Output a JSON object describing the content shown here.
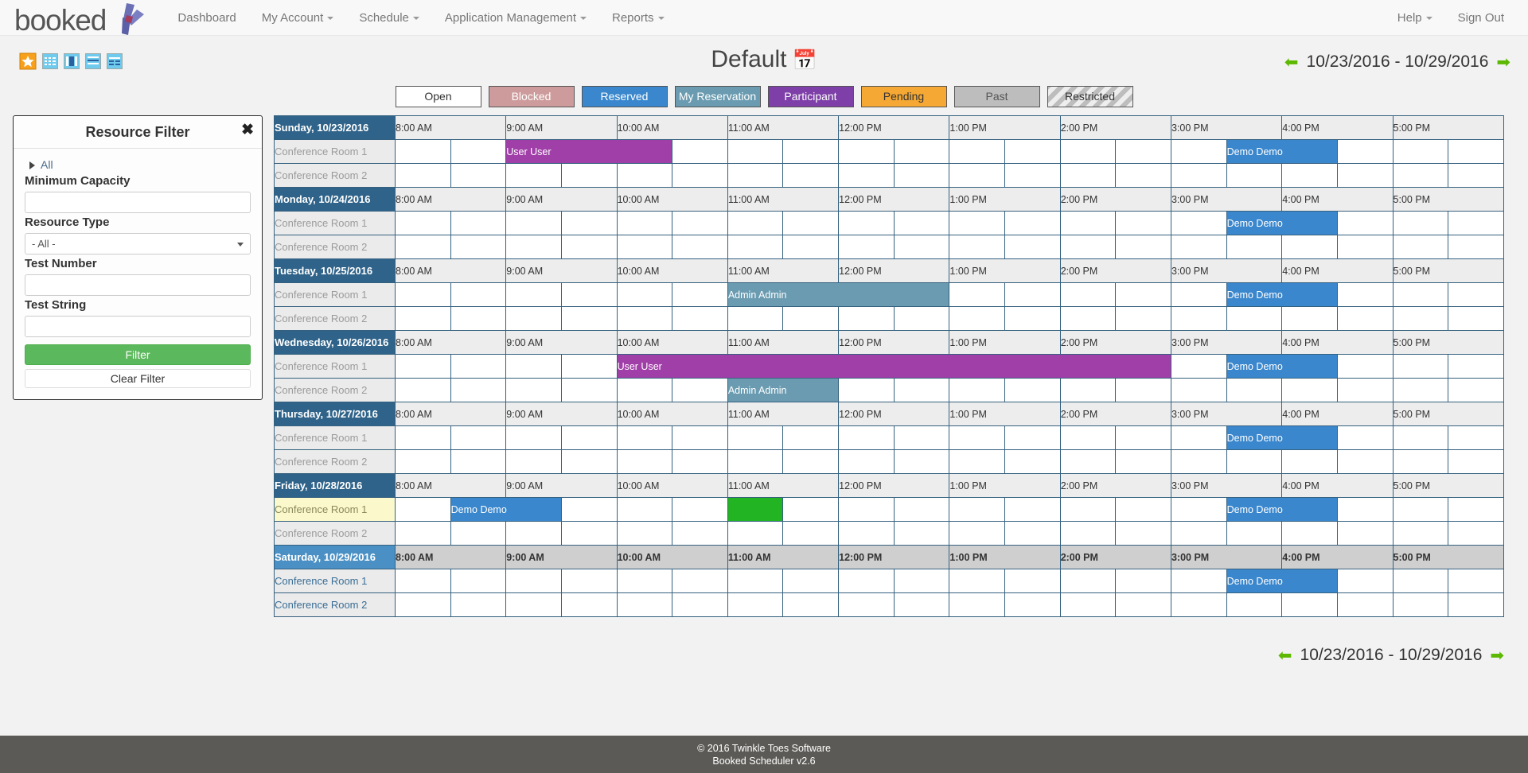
{
  "navbar": {
    "brand": "booked",
    "links": [
      {
        "label": "Dashboard",
        "caret": false
      },
      {
        "label": "My Account",
        "caret": true
      },
      {
        "label": "Schedule",
        "caret": true
      },
      {
        "label": "Application Management",
        "caret": true
      },
      {
        "label": "Reports",
        "caret": true
      }
    ],
    "right_links": [
      {
        "label": "Help",
        "caret": true
      },
      {
        "label": "Sign Out",
        "caret": false
      }
    ]
  },
  "toolbar": {
    "icons": [
      "star-icon",
      "calendar-month-view-icon",
      "calendar-day-view-icon",
      "calendar-week-view-icon",
      "calendar-list-view-icon"
    ]
  },
  "header": {
    "title": "Default",
    "calendar_icon": "📅",
    "date_range": "10/23/2016 - 10/29/2016",
    "prev_arrow": "⬅",
    "next_arrow": "➡"
  },
  "legend": [
    {
      "label": "Open",
      "bg": "#ffffff",
      "fg": "#333333",
      "striped": false
    },
    {
      "label": "Blocked",
      "bg": "#cd9b9b",
      "fg": "#ffffff",
      "striped": false
    },
    {
      "label": "Reserved",
      "bg": "#3a87cd",
      "fg": "#ffffff",
      "striped": false
    },
    {
      "label": "My Reservation",
      "bg": "#6a9bb0",
      "fg": "#ffffff",
      "striped": false
    },
    {
      "label": "Participant",
      "bg": "#7e3fa8",
      "fg": "#ffffff",
      "striped": false
    },
    {
      "label": "Pending",
      "bg": "#f5a833",
      "fg": "#333333",
      "striped": false
    },
    {
      "label": "Past",
      "bg": "#bdbdbd",
      "fg": "#555555",
      "striped": false
    },
    {
      "label": "Restricted",
      "bg": "#bdbdbd",
      "fg": "#333333",
      "striped": true
    }
  ],
  "filter": {
    "title": "Resource Filter",
    "close_label": "✖",
    "tree_all": "All",
    "min_capacity_label": "Minimum Capacity",
    "min_capacity_value": "",
    "resource_type_label": "Resource Type",
    "resource_type_value": "- All -",
    "test_number_label": "Test Number",
    "test_number_value": "",
    "test_string_label": "Test String",
    "test_string_value": "",
    "filter_button": "Filter",
    "clear_button": "Clear Filter"
  },
  "schedule": {
    "times": [
      "8:00 AM",
      "9:00 AM",
      "10:00 AM",
      "11:00 AM",
      "12:00 PM",
      "1:00 PM",
      "2:00 PM",
      "3:00 PM",
      "4:00 PM",
      "5:00 PM"
    ],
    "rooms": [
      "Conference Room 1",
      "Conference Room 2"
    ],
    "days": [
      {
        "date": "Sunday, 10/23/2016",
        "today": false,
        "rows": [
          {
            "room": "Conference Room 1",
            "highlight": false,
            "reservations": [
              {
                "label": "User User",
                "start": 2,
                "span": 3,
                "color": "#a13fa8"
              },
              {
                "label": "Demo Demo",
                "start": 15,
                "span": 2,
                "color": "#3a87cd"
              }
            ]
          },
          {
            "room": "Conference Room 2",
            "highlight": false,
            "reservations": []
          }
        ]
      },
      {
        "date": "Monday, 10/24/2016",
        "today": false,
        "rows": [
          {
            "room": "Conference Room 1",
            "highlight": false,
            "reservations": [
              {
                "label": "Demo Demo",
                "start": 15,
                "span": 2,
                "color": "#3a87cd"
              }
            ]
          },
          {
            "room": "Conference Room 2",
            "highlight": false,
            "reservations": []
          }
        ]
      },
      {
        "date": "Tuesday, 10/25/2016",
        "today": false,
        "rows": [
          {
            "room": "Conference Room 1",
            "highlight": false,
            "reservations": [
              {
                "label": "Admin Admin",
                "start": 6,
                "span": 4,
                "color": "#6a9bb0"
              },
              {
                "label": "Demo Demo",
                "start": 15,
                "span": 2,
                "color": "#3a87cd"
              }
            ]
          },
          {
            "room": "Conference Room 2",
            "highlight": false,
            "reservations": []
          }
        ]
      },
      {
        "date": "Wednesday, 10/26/2016",
        "today": false,
        "rows": [
          {
            "room": "Conference Room 1",
            "highlight": false,
            "reservations": [
              {
                "label": "User User",
                "start": 4,
                "span": 10,
                "color": "#a13fa8"
              },
              {
                "label": "Demo Demo",
                "start": 15,
                "span": 2,
                "color": "#3a87cd"
              }
            ]
          },
          {
            "room": "Conference Room 2",
            "highlight": false,
            "reservations": [
              {
                "label": "Admin Admin",
                "start": 6,
                "span": 2,
                "color": "#6a9bb0"
              }
            ]
          }
        ]
      },
      {
        "date": "Thursday, 10/27/2016",
        "today": false,
        "rows": [
          {
            "room": "Conference Room 1",
            "highlight": false,
            "reservations": [
              {
                "label": "Demo Demo",
                "start": 15,
                "span": 2,
                "color": "#3a87cd"
              }
            ]
          },
          {
            "room": "Conference Room 2",
            "highlight": false,
            "reservations": []
          }
        ]
      },
      {
        "date": "Friday, 10/28/2016",
        "today": false,
        "rows": [
          {
            "room": "Conference Room 1",
            "highlight": true,
            "reservations": [
              {
                "label": "Demo Demo",
                "start": 1,
                "span": 2,
                "color": "#3a87cd"
              },
              {
                "label": "",
                "start": 6,
                "span": 1,
                "color": "#22b422"
              },
              {
                "label": "Demo Demo",
                "start": 15,
                "span": 2,
                "color": "#3a87cd"
              }
            ]
          },
          {
            "room": "Conference Room 2",
            "highlight": false,
            "reservations": []
          }
        ]
      },
      {
        "date": "Saturday, 10/29/2016",
        "today": true,
        "rows": [
          {
            "room": "Conference Room 1",
            "highlight": false,
            "reservations": [
              {
                "label": "Demo Demo",
                "start": 15,
                "span": 2,
                "color": "#3a87cd"
              }
            ]
          },
          {
            "room": "Conference Room 2",
            "highlight": false,
            "reservations": []
          }
        ]
      }
    ]
  },
  "footer": {
    "line1": "© 2016 Twinkle Toes Software",
    "line2": "Booked Scheduler v2.6"
  }
}
